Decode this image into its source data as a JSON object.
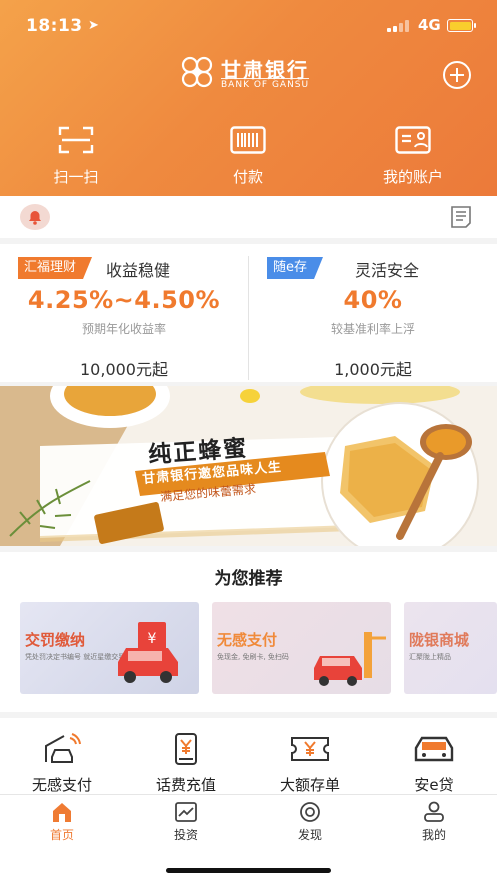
{
  "status_bar": {
    "time": "18:13",
    "network": "4G"
  },
  "header": {
    "bank_name": "甘肃银行",
    "bank_name_en": "BANK OF GANSU",
    "quick_actions": [
      {
        "label": "扫一扫",
        "icon": "scan-icon"
      },
      {
        "label": "付款",
        "icon": "barcode-icon"
      },
      {
        "label": "我的账户",
        "icon": "account-card-icon"
      }
    ]
  },
  "products": [
    {
      "tag": "汇福理财",
      "tag_color": "#f07a2e",
      "slogan": "收益稳健",
      "rate": "4.25%~4.50%",
      "rate_label": "预期年化收益率",
      "min": "10,000元起"
    },
    {
      "tag": "随e存",
      "tag_color": "#4a8de8",
      "slogan": "灵活安全",
      "rate": "40%",
      "rate_label": "较基准利率上浮",
      "min": "1,000元起"
    }
  ],
  "banner": {
    "title": "纯正蜂蜜",
    "ribbon": "甘肃银行邀您品味人生",
    "sub": "满足您的味蕾需求"
  },
  "recommend": {
    "title": "为您推荐",
    "cards": [
      {
        "title": "交罚缴纳",
        "sub": "凭处罚决定书编号 就近星缴交罚",
        "title_color": "#e05a3a"
      },
      {
        "title": "无感支付",
        "sub": "免现金, 免刷卡, 免扫码",
        "title_color": "#f08a3a"
      },
      {
        "title": "陇银商城",
        "sub": "汇聚陇上精品",
        "title_color": "#e07a5a"
      }
    ]
  },
  "services": [
    {
      "label": "无感支付",
      "icon": "car-wireless-icon"
    },
    {
      "label": "话费充值",
      "icon": "phone-yuan-icon"
    },
    {
      "label": "大额存单",
      "icon": "yuan-ticket-icon"
    },
    {
      "label": "安e贷",
      "icon": "car-icon"
    }
  ],
  "tabs": [
    {
      "label": "首页",
      "icon": "home-icon",
      "active": true
    },
    {
      "label": "投资",
      "icon": "chart-icon",
      "active": false
    },
    {
      "label": "发现",
      "icon": "discover-icon",
      "active": false
    },
    {
      "label": "我的",
      "icon": "user-icon",
      "active": false
    }
  ],
  "colors": {
    "accent": "#ef7b33",
    "header_start": "#f4a24a",
    "header_end": "#ec7a3a"
  }
}
